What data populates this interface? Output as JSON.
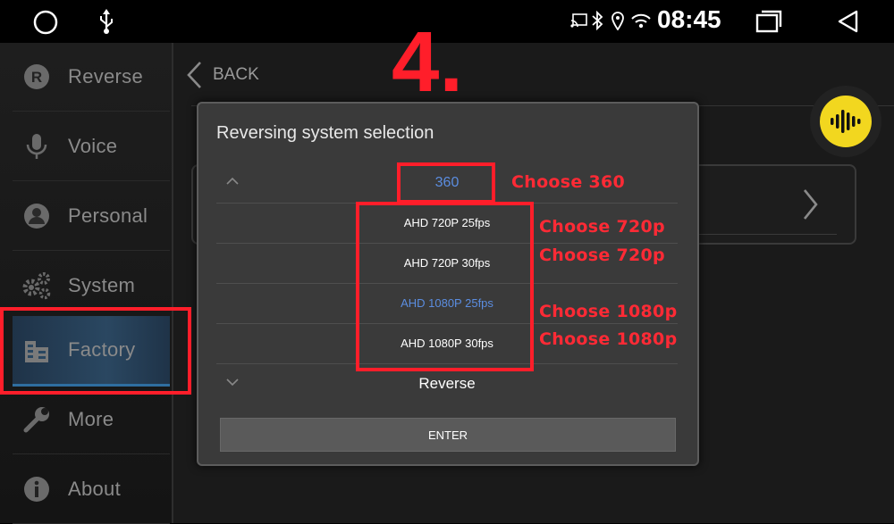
{
  "status_bar": {
    "time": "08:45",
    "icons": [
      "home-circle-icon",
      "usb-icon",
      "cast-icon",
      "bluetooth-icon",
      "location-icon",
      "wifi-icon",
      "recents-icon",
      "back-triangle-icon"
    ]
  },
  "sidebar": {
    "items": [
      {
        "label": "Reverse",
        "icon": "reverse-r-icon"
      },
      {
        "label": "Voice",
        "icon": "microphone-icon"
      },
      {
        "label": "Personal",
        "icon": "person-icon"
      },
      {
        "label": "System",
        "icon": "gears-icon"
      },
      {
        "label": "Factory",
        "icon": "factory-icon",
        "active": true
      },
      {
        "label": "More",
        "icon": "wrench-icon"
      },
      {
        "label": "About",
        "icon": "info-icon"
      }
    ]
  },
  "header": {
    "back_label": "BACK"
  },
  "step_label": "4.",
  "dialog": {
    "title": "Reversing system selection",
    "top_option": "360",
    "options": [
      {
        "label": "AHD 720P 25fps",
        "selected": false
      },
      {
        "label": "AHD 720P 30fps",
        "selected": false
      },
      {
        "label": "AHD 1080P 25fps",
        "selected": true
      },
      {
        "label": "AHD 1080P 30fps",
        "selected": false
      }
    ],
    "bottom_option": "Reverse",
    "enter_label": "ENTER"
  },
  "annotations": {
    "a360": "Choose 360",
    "a720a": "Choose 720p",
    "a720b": "Choose 720p",
    "a1080a": "Choose 1080p",
    "a1080b": "Choose 1080p"
  },
  "colors": {
    "accent_red": "#ff1e2a",
    "selected_blue": "#5b8de0",
    "voice_yellow": "#f2d71f",
    "active_item": "#2a4761"
  }
}
